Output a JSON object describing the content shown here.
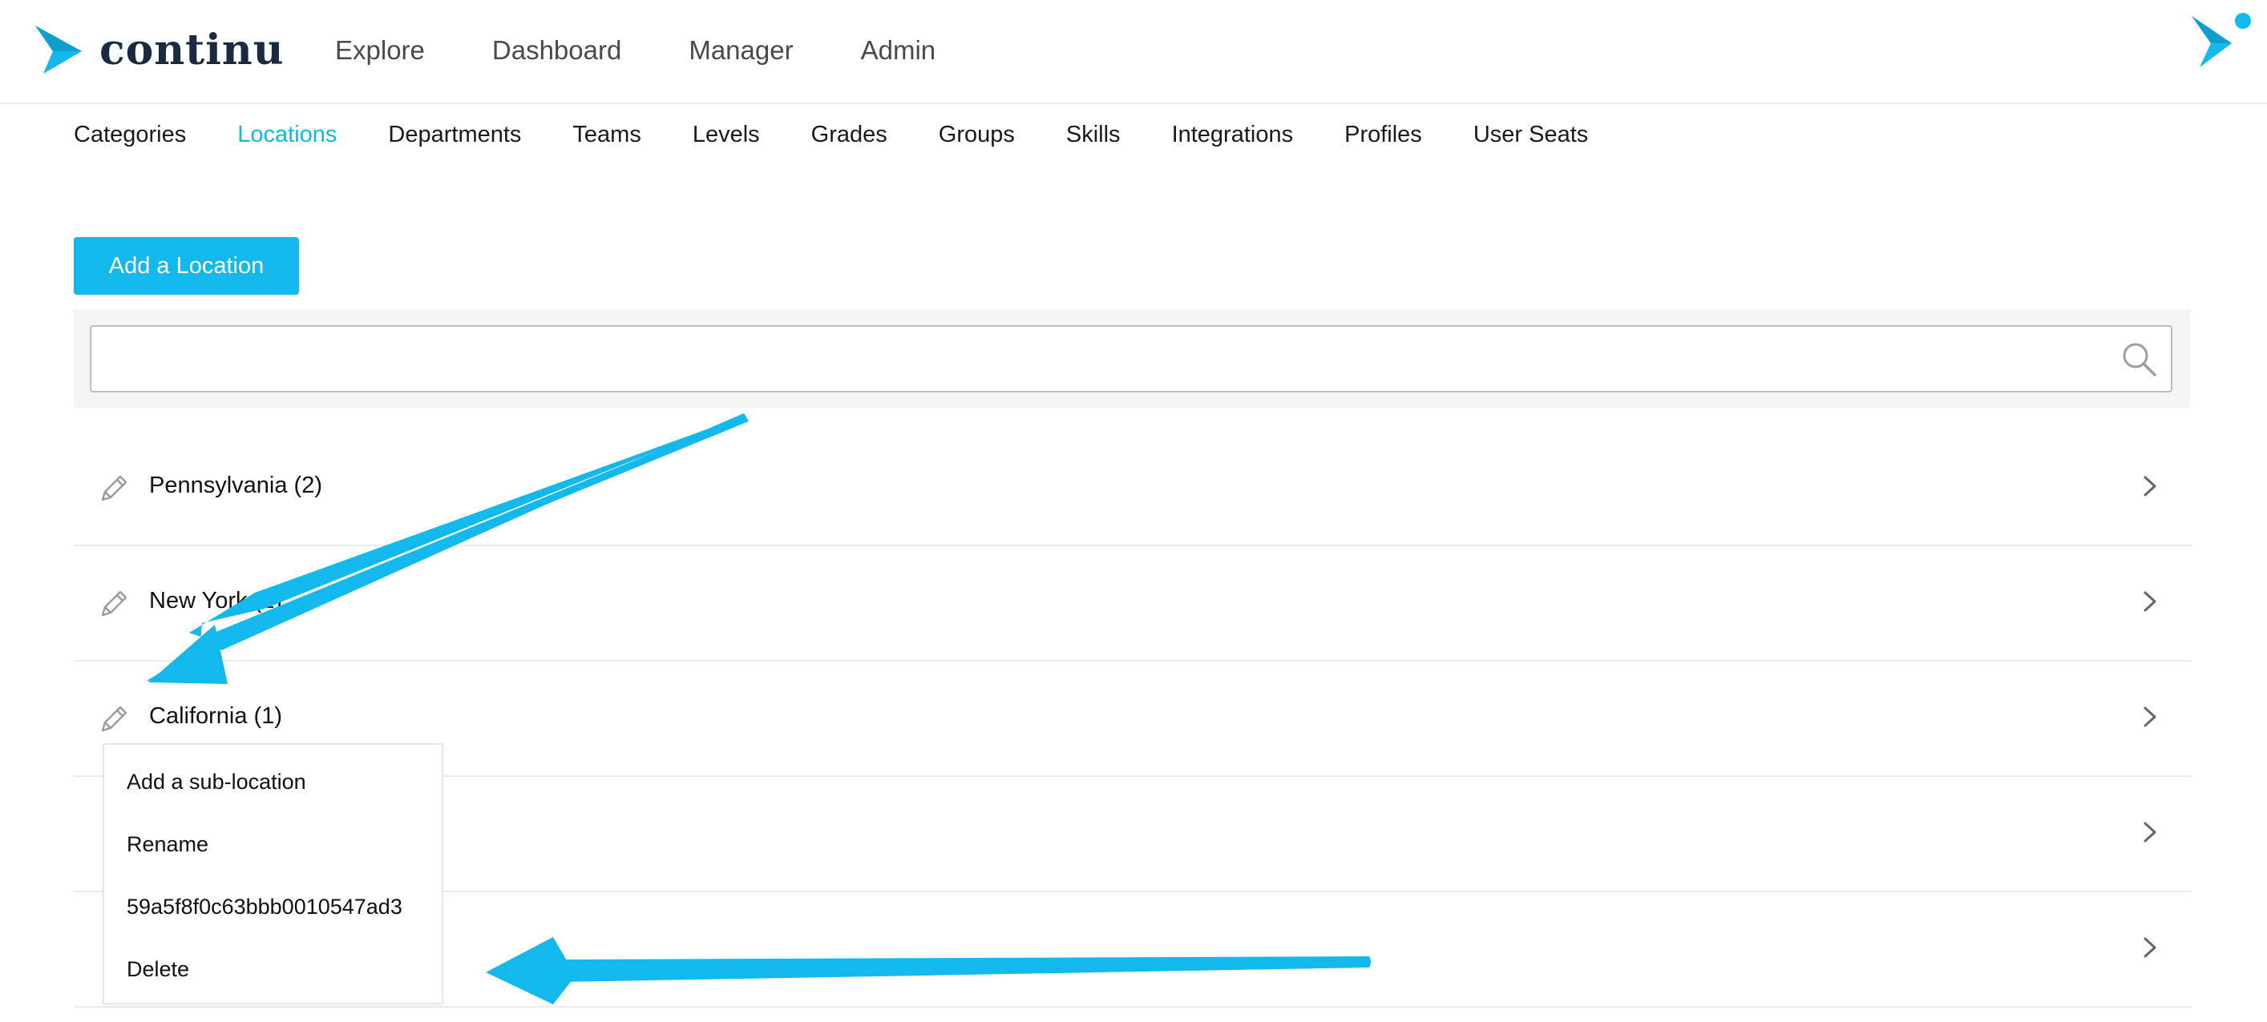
{
  "header": {
    "logo_text": "continu",
    "nav": [
      "Explore",
      "Dashboard",
      "Manager",
      "Admin"
    ]
  },
  "subnav": {
    "tabs": [
      "Categories",
      "Locations",
      "Departments",
      "Teams",
      "Levels",
      "Grades",
      "Groups",
      "Skills",
      "Integrations",
      "Profiles",
      "User Seats"
    ],
    "active": "Locations"
  },
  "actions": {
    "add_location": "Add a Location"
  },
  "search": {
    "value": "",
    "placeholder": ""
  },
  "locations": [
    {
      "label": "Pennsylvania (2)"
    },
    {
      "label": "New York (1)"
    },
    {
      "label": "California (1)"
    },
    {
      "label": ""
    },
    {
      "label": ""
    }
  ],
  "context_menu": {
    "items": [
      "Add a sub-location",
      "Rename",
      "59a5f8f0c63bbb0010547ad3",
      "Delete"
    ]
  },
  "colors": {
    "accent": "#13b9ec",
    "logo_dark": "#1b2a41",
    "annotation": "#13b9ec"
  },
  "icons": [
    "continu-logo-icon",
    "search-icon",
    "pencil-icon",
    "chevron-right-icon",
    "brand-icon"
  ]
}
